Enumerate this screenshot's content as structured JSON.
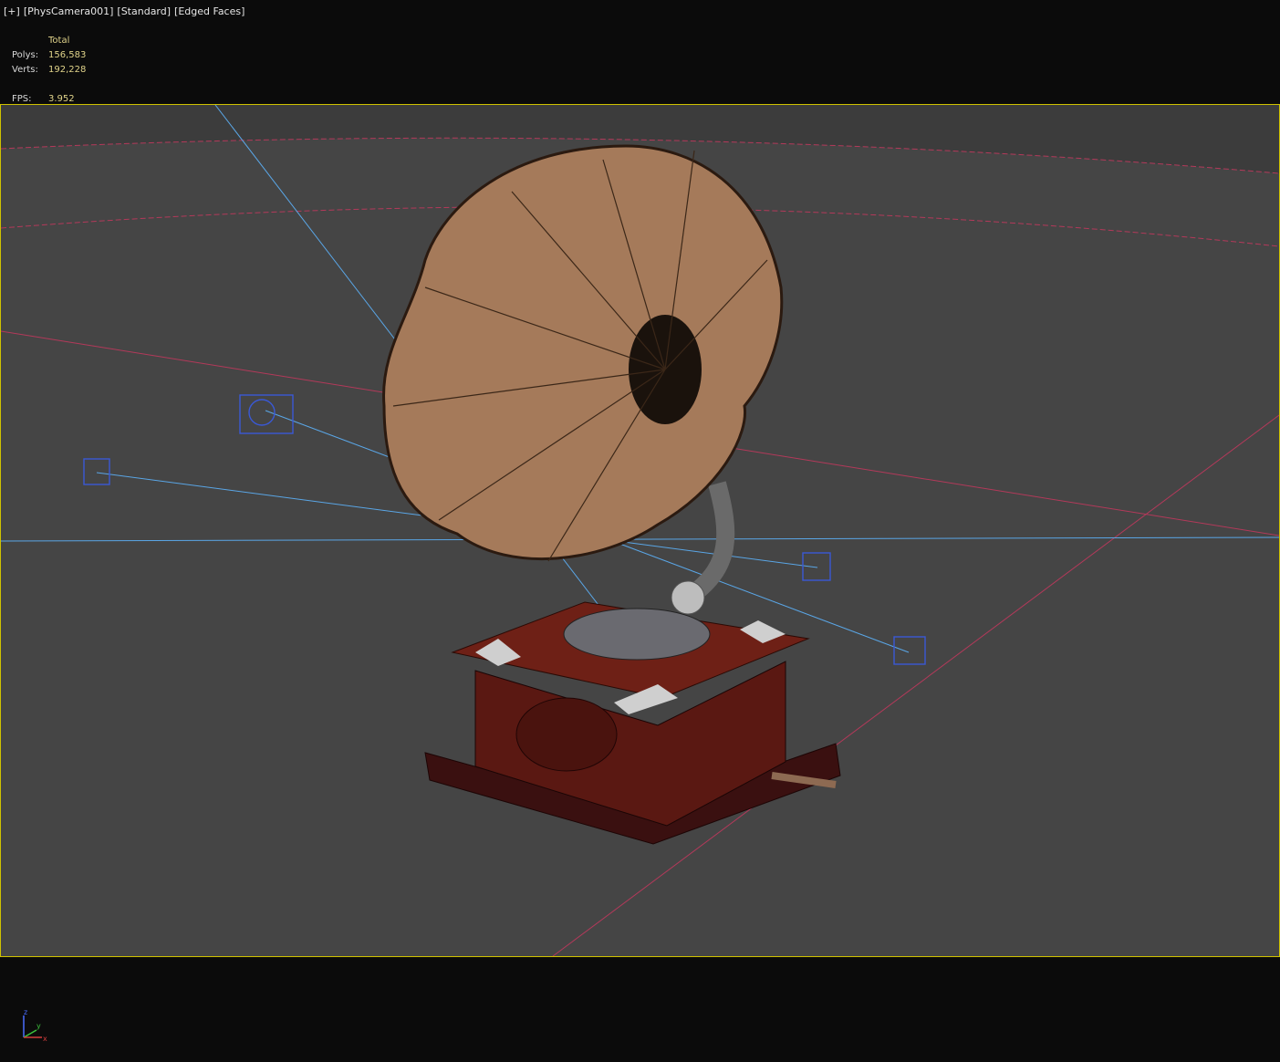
{
  "viewport": {
    "labels": [
      "[+]",
      "[PhysCamera001]",
      "[Standard]",
      "[Edged Faces]"
    ]
  },
  "stats": {
    "header": "Total",
    "polys_label": "Polys:",
    "polys_value": "156,583",
    "verts_label": "Verts:",
    "verts_value": "192,228",
    "fps_label": "FPS:",
    "fps_value": "3.952"
  },
  "gizmo": {
    "z": "z",
    "y": "y",
    "x": "x"
  },
  "colors": {
    "background": "#0b0b0b",
    "viewport": "#454545",
    "viewport_border": "#cfc200",
    "grid_red": "#b3395a",
    "light_blue": "#5aa6e6",
    "horn": "#a57a5a",
    "cabinet": "#4a1510"
  }
}
